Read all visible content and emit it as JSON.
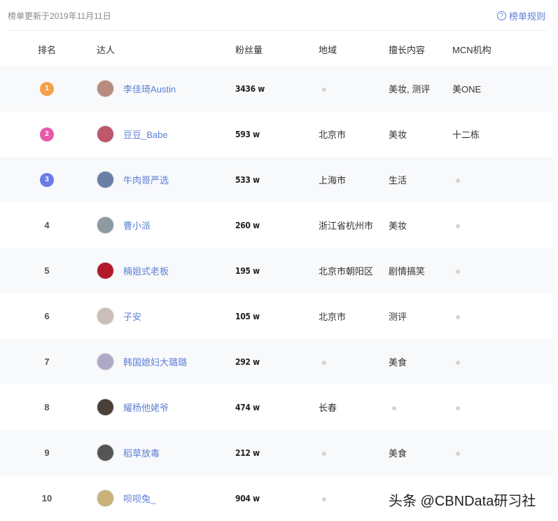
{
  "header": {
    "updated": "榜单更新于2019年11月11日",
    "rules_label": "榜单规则",
    "rules_icon": "question-circle-icon"
  },
  "columns": [
    "排名",
    "达人",
    "粉丝量",
    "地域",
    "擅长内容",
    "MCN机构"
  ],
  "colors": {
    "link": "#5b7fd6",
    "gold": "#f5a04a",
    "pink": "#e85aa8",
    "blue": "#6b7ce8"
  },
  "rows": [
    {
      "rank": "1",
      "name": "李佳琦Austin",
      "fans": "3436 w",
      "region": "",
      "content": "美妆, 测评",
      "mcn": "美ONE",
      "avatar": "#b98a7e"
    },
    {
      "rank": "2",
      "name": "豆豆_Babe",
      "fans": "593 w",
      "region": "北京市",
      "content": "美妆",
      "mcn": "十二栋",
      "avatar": "#c0566a"
    },
    {
      "rank": "3",
      "name": "牛肉哥严选",
      "fans": "533 w",
      "region": "上海市",
      "content": "生活",
      "mcn": "",
      "avatar": "#6a7fa8"
    },
    {
      "rank": "4",
      "name": "曹小派",
      "fans": "260 w",
      "region": "浙江省杭州市",
      "content": "美妆",
      "mcn": "",
      "avatar": "#8d9aa0"
    },
    {
      "rank": "5",
      "name": "楠姐式老板",
      "fans": "195 w",
      "region": "北京市朝阳区",
      "content": "剧情搞笑",
      "mcn": "",
      "avatar": "#b21a2a"
    },
    {
      "rank": "6",
      "name": "子安",
      "fans": "105 w",
      "region": "北京市",
      "content": "测评",
      "mcn": "",
      "avatar": "#c9bfb8"
    },
    {
      "rank": "7",
      "name": "韩国媳妇大璐璐",
      "fans": "292 w",
      "region": "",
      "content": "美食",
      "mcn": "",
      "avatar": "#b0a8c8"
    },
    {
      "rank": "8",
      "name": "耀杨他姥爷",
      "fans": "474 w",
      "region": "长春",
      "content": "",
      "mcn": "",
      "avatar": "#4a4038"
    },
    {
      "rank": "9",
      "name": "稻草放毒",
      "fans": "212 w",
      "region": "",
      "content": "美食",
      "mcn": "",
      "avatar": "#555"
    },
    {
      "rank": "10",
      "name": "呗呗兔_",
      "fans": "904 w",
      "region": "",
      "content": "",
      "mcn": "",
      "avatar": "#c8b27a"
    }
  ],
  "watermark": "头条 @CBNData研习社"
}
